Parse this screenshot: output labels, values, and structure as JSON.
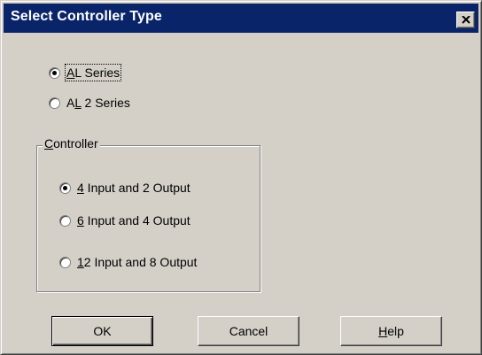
{
  "window": {
    "title": "Select Controller Type",
    "close_icon": "close-icon"
  },
  "series": {
    "options": [
      {
        "pre": "",
        "mnemonic": "A",
        "post": "L Series",
        "selected": true
      },
      {
        "pre": "A",
        "mnemonic": "L",
        "post": " 2 Series",
        "selected": false
      }
    ]
  },
  "controller": {
    "group_mnemonic": "C",
    "group_rest": "ontroller",
    "options": [
      {
        "mnemonic": "4",
        "post": " Input and 2 Output",
        "selected": true
      },
      {
        "mnemonic": "6",
        "post": " Input and 4 Output",
        "selected": false
      },
      {
        "mnemonic": "1",
        "post": "2 Input and 8 Output",
        "selected": false
      }
    ]
  },
  "buttons": {
    "ok": "OK",
    "cancel": "Cancel",
    "help_mnemonic": "H",
    "help_rest": "elp"
  }
}
